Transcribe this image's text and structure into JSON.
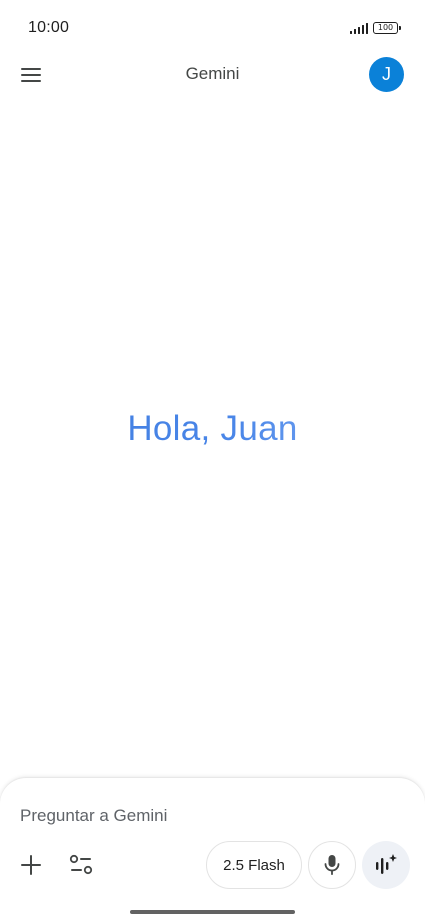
{
  "status_bar": {
    "time": "10:00",
    "battery": "100",
    "icons": [
      "signal-icon",
      "battery-icon"
    ]
  },
  "app_bar": {
    "title": "Gemini",
    "menu_icon": "menu-icon",
    "avatar_initial": "J",
    "avatar_color": "#0b81d8"
  },
  "main": {
    "greeting": "Hola, Juan",
    "greeting_colors": [
      "#3f7de0",
      "#8ab4f8"
    ]
  },
  "composer": {
    "placeholder": "Preguntar a Gemini",
    "value": "",
    "add_icon": "plus-icon",
    "tools_icon": "tools-sliders-icon",
    "model_label": "2.5 Flash",
    "mic_icon": "microphone-icon",
    "live_icon": "live-audio-sparkle-icon"
  }
}
